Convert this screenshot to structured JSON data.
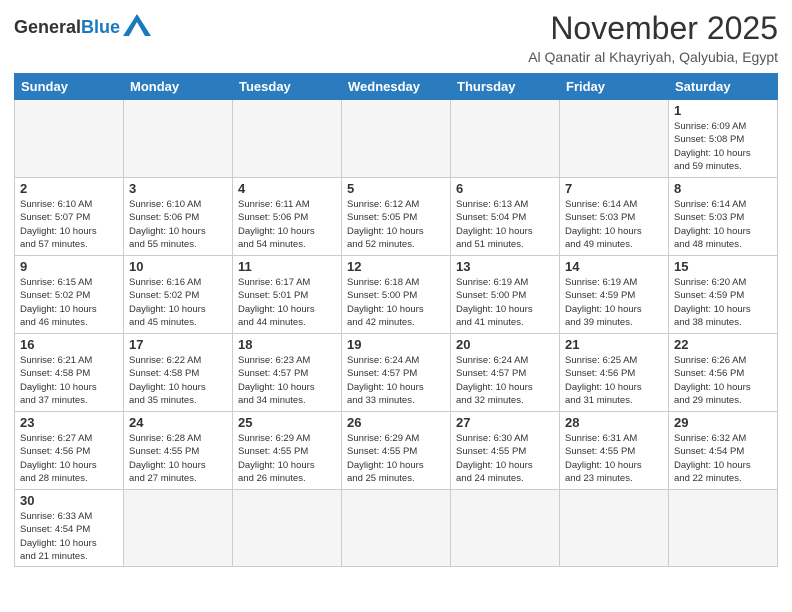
{
  "logo": {
    "general": "General",
    "blue": "Blue"
  },
  "title": "November 2025",
  "location": "Al Qanatir al Khayriyah, Qalyubia, Egypt",
  "days_of_week": [
    "Sunday",
    "Monday",
    "Tuesday",
    "Wednesday",
    "Thursday",
    "Friday",
    "Saturday"
  ],
  "weeks": [
    [
      {
        "day": "",
        "info": ""
      },
      {
        "day": "",
        "info": ""
      },
      {
        "day": "",
        "info": ""
      },
      {
        "day": "",
        "info": ""
      },
      {
        "day": "",
        "info": ""
      },
      {
        "day": "",
        "info": ""
      },
      {
        "day": "1",
        "info": "Sunrise: 6:09 AM\nSunset: 5:08 PM\nDaylight: 10 hours\nand 59 minutes."
      }
    ],
    [
      {
        "day": "2",
        "info": "Sunrise: 6:10 AM\nSunset: 5:07 PM\nDaylight: 10 hours\nand 57 minutes."
      },
      {
        "day": "3",
        "info": "Sunrise: 6:10 AM\nSunset: 5:06 PM\nDaylight: 10 hours\nand 55 minutes."
      },
      {
        "day": "4",
        "info": "Sunrise: 6:11 AM\nSunset: 5:06 PM\nDaylight: 10 hours\nand 54 minutes."
      },
      {
        "day": "5",
        "info": "Sunrise: 6:12 AM\nSunset: 5:05 PM\nDaylight: 10 hours\nand 52 minutes."
      },
      {
        "day": "6",
        "info": "Sunrise: 6:13 AM\nSunset: 5:04 PM\nDaylight: 10 hours\nand 51 minutes."
      },
      {
        "day": "7",
        "info": "Sunrise: 6:14 AM\nSunset: 5:03 PM\nDaylight: 10 hours\nand 49 minutes."
      },
      {
        "day": "8",
        "info": "Sunrise: 6:14 AM\nSunset: 5:03 PM\nDaylight: 10 hours\nand 48 minutes."
      }
    ],
    [
      {
        "day": "9",
        "info": "Sunrise: 6:15 AM\nSunset: 5:02 PM\nDaylight: 10 hours\nand 46 minutes."
      },
      {
        "day": "10",
        "info": "Sunrise: 6:16 AM\nSunset: 5:02 PM\nDaylight: 10 hours\nand 45 minutes."
      },
      {
        "day": "11",
        "info": "Sunrise: 6:17 AM\nSunset: 5:01 PM\nDaylight: 10 hours\nand 44 minutes."
      },
      {
        "day": "12",
        "info": "Sunrise: 6:18 AM\nSunset: 5:00 PM\nDaylight: 10 hours\nand 42 minutes."
      },
      {
        "day": "13",
        "info": "Sunrise: 6:19 AM\nSunset: 5:00 PM\nDaylight: 10 hours\nand 41 minutes."
      },
      {
        "day": "14",
        "info": "Sunrise: 6:19 AM\nSunset: 4:59 PM\nDaylight: 10 hours\nand 39 minutes."
      },
      {
        "day": "15",
        "info": "Sunrise: 6:20 AM\nSunset: 4:59 PM\nDaylight: 10 hours\nand 38 minutes."
      }
    ],
    [
      {
        "day": "16",
        "info": "Sunrise: 6:21 AM\nSunset: 4:58 PM\nDaylight: 10 hours\nand 37 minutes."
      },
      {
        "day": "17",
        "info": "Sunrise: 6:22 AM\nSunset: 4:58 PM\nDaylight: 10 hours\nand 35 minutes."
      },
      {
        "day": "18",
        "info": "Sunrise: 6:23 AM\nSunset: 4:57 PM\nDaylight: 10 hours\nand 34 minutes."
      },
      {
        "day": "19",
        "info": "Sunrise: 6:24 AM\nSunset: 4:57 PM\nDaylight: 10 hours\nand 33 minutes."
      },
      {
        "day": "20",
        "info": "Sunrise: 6:24 AM\nSunset: 4:57 PM\nDaylight: 10 hours\nand 32 minutes."
      },
      {
        "day": "21",
        "info": "Sunrise: 6:25 AM\nSunset: 4:56 PM\nDaylight: 10 hours\nand 31 minutes."
      },
      {
        "day": "22",
        "info": "Sunrise: 6:26 AM\nSunset: 4:56 PM\nDaylight: 10 hours\nand 29 minutes."
      }
    ],
    [
      {
        "day": "23",
        "info": "Sunrise: 6:27 AM\nSunset: 4:56 PM\nDaylight: 10 hours\nand 28 minutes."
      },
      {
        "day": "24",
        "info": "Sunrise: 6:28 AM\nSunset: 4:55 PM\nDaylight: 10 hours\nand 27 minutes."
      },
      {
        "day": "25",
        "info": "Sunrise: 6:29 AM\nSunset: 4:55 PM\nDaylight: 10 hours\nand 26 minutes."
      },
      {
        "day": "26",
        "info": "Sunrise: 6:29 AM\nSunset: 4:55 PM\nDaylight: 10 hours\nand 25 minutes."
      },
      {
        "day": "27",
        "info": "Sunrise: 6:30 AM\nSunset: 4:55 PM\nDaylight: 10 hours\nand 24 minutes."
      },
      {
        "day": "28",
        "info": "Sunrise: 6:31 AM\nSunset: 4:55 PM\nDaylight: 10 hours\nand 23 minutes."
      },
      {
        "day": "29",
        "info": "Sunrise: 6:32 AM\nSunset: 4:54 PM\nDaylight: 10 hours\nand 22 minutes."
      }
    ],
    [
      {
        "day": "30",
        "info": "Sunrise: 6:33 AM\nSunset: 4:54 PM\nDaylight: 10 hours\nand 21 minutes."
      },
      {
        "day": "",
        "info": ""
      },
      {
        "day": "",
        "info": ""
      },
      {
        "day": "",
        "info": ""
      },
      {
        "day": "",
        "info": ""
      },
      {
        "day": "",
        "info": ""
      },
      {
        "day": "",
        "info": ""
      }
    ]
  ]
}
